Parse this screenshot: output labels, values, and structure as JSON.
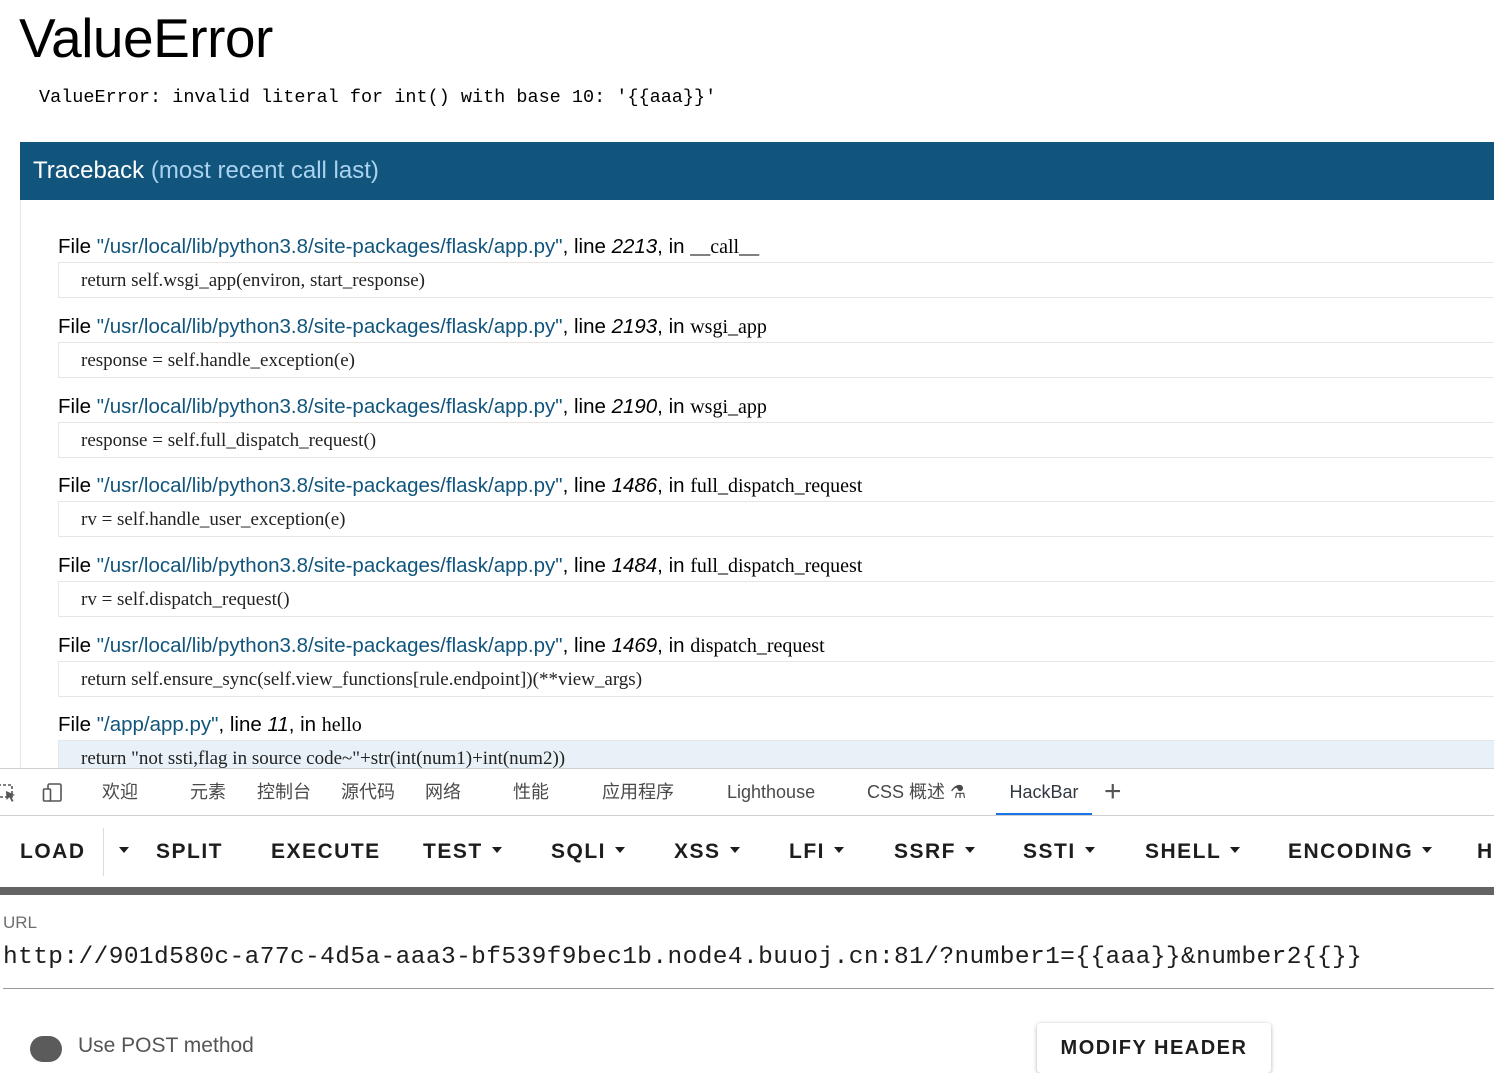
{
  "page": {
    "title": "ValueError",
    "message": "ValueError: invalid literal for int() with base 10: '{{aaa}}'",
    "traceback_title": "Traceback",
    "traceback_subtitle": "(most recent call last)",
    "frames": [
      {
        "file_word": "File",
        "path": "\"/usr/local/lib/python3.8/site-packages/flask/app.py\"",
        "line_word": ", line ",
        "line": "2213",
        "in_word": ", in ",
        "func": "__call__",
        "code": "return self.wsgi_app(environ, start_response)"
      },
      {
        "file_word": "File",
        "path": "\"/usr/local/lib/python3.8/site-packages/flask/app.py\"",
        "line_word": ", line ",
        "line": "2193",
        "in_word": ", in ",
        "func": "wsgi_app",
        "code": "response = self.handle_exception(e)"
      },
      {
        "file_word": "File",
        "path": "\"/usr/local/lib/python3.8/site-packages/flask/app.py\"",
        "line_word": ", line ",
        "line": "2190",
        "in_word": ", in ",
        "func": "wsgi_app",
        "code": "response = self.full_dispatch_request()"
      },
      {
        "file_word": "File",
        "path": "\"/usr/local/lib/python3.8/site-packages/flask/app.py\"",
        "line_word": ", line ",
        "line": "1486",
        "in_word": ", in ",
        "func": "full_dispatch_request",
        "code": "rv = self.handle_user_exception(e)"
      },
      {
        "file_word": "File",
        "path": "\"/usr/local/lib/python3.8/site-packages/flask/app.py\"",
        "line_word": ", line ",
        "line": "1484",
        "in_word": ", in ",
        "func": "full_dispatch_request",
        "code": "rv = self.dispatch_request()"
      },
      {
        "file_word": "File",
        "path": "\"/usr/local/lib/python3.8/site-packages/flask/app.py\"",
        "line_word": ", line ",
        "line": "1469",
        "in_word": ", in ",
        "func": "dispatch_request",
        "code": "return self.ensure_sync(self.view_functions[rule.endpoint])(**view_args)"
      },
      {
        "file_word": "File",
        "path": "\"/app/app.py\"",
        "line_word": ", line ",
        "line": "11",
        "in_word": ", in ",
        "func": "hello",
        "code": "return \"not ssti,flag in source code~\"+str(int(num1)+int(num2))"
      }
    ]
  },
  "devtools": {
    "icons": [
      "inspect-element-icon",
      "device-toolbar-icon"
    ],
    "tabs": [
      "欢迎",
      "元素",
      "控制台",
      "源代码",
      "网络",
      "性能",
      "应用程序",
      "Lighthouse",
      "CSS 概述 ⚗",
      "HackBar"
    ],
    "active_tab": "HackBar",
    "add_tab": "+"
  },
  "hackbar": {
    "buttons": [
      "LOAD",
      "SPLIT",
      "EXECUTE",
      "TEST",
      "SQLI",
      "XSS",
      "LFI",
      "SSRF",
      "SSTI",
      "SHELL",
      "ENCODING",
      "H"
    ],
    "url_label": "URL",
    "url_value": "http://901d580c-a77c-4d5a-aaa3-bf539f9bec1b.node4.buuoj.cn:81/?number1={{aaa}}&number2{{}}",
    "post_label": "Use POST method",
    "post_enabled": false,
    "modify_header": "MODIFY HEADER"
  },
  "colors": {
    "traceback_header_bg": "#11557c",
    "path_color": "#11557c",
    "active_tab_underline": "#1a73e8"
  }
}
